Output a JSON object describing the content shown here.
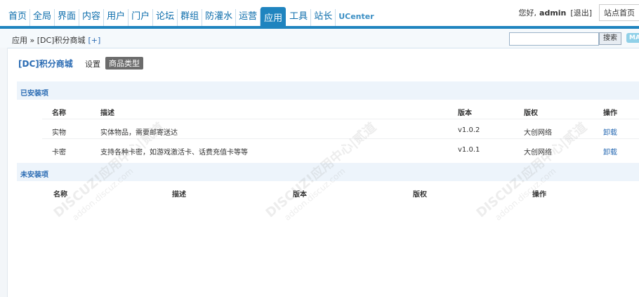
{
  "topnav": {
    "items": [
      "首页",
      "全局",
      "界面",
      "内容",
      "用户",
      "门户",
      "论坛",
      "群组",
      "防灌水",
      "运营",
      "应用",
      "工具",
      "站长",
      "UCenter"
    ],
    "active": "应用"
  },
  "header": {
    "greeting": "您好,",
    "username": "admin",
    "logout": "[退出]",
    "site_button": "站点首页"
  },
  "breadcrumb": {
    "path": "应用 » [DC]积分商城",
    "add": "[+]"
  },
  "search": {
    "value": "",
    "button": "搜索",
    "map_button": "MAP"
  },
  "plugin": {
    "title": "[DC]积分商城",
    "tabs": {
      "settings": "设置",
      "types": "商品类型"
    }
  },
  "installed": {
    "heading": "已安装项",
    "columns": [
      "名称",
      "描述",
      "版本",
      "版权",
      "操作"
    ],
    "rows": [
      {
        "name": "实物",
        "desc": "实体物品，需要邮寄送达",
        "version": "v1.0.2",
        "copyright": "大创网络",
        "action": "卸载"
      },
      {
        "name": "卡密",
        "desc": "支持各种卡密，如游戏激活卡、话费充值卡等等",
        "version": "v1.0.1",
        "copyright": "大创网络",
        "action": "卸载"
      }
    ]
  },
  "uninstalled": {
    "heading": "未安装项",
    "columns": [
      "名称",
      "描述",
      "版本",
      "版权",
      "操作"
    ]
  },
  "watermark": {
    "brand": "DISCUZ!应用中心|贰道",
    "domain": "addon.discuz.com"
  }
}
